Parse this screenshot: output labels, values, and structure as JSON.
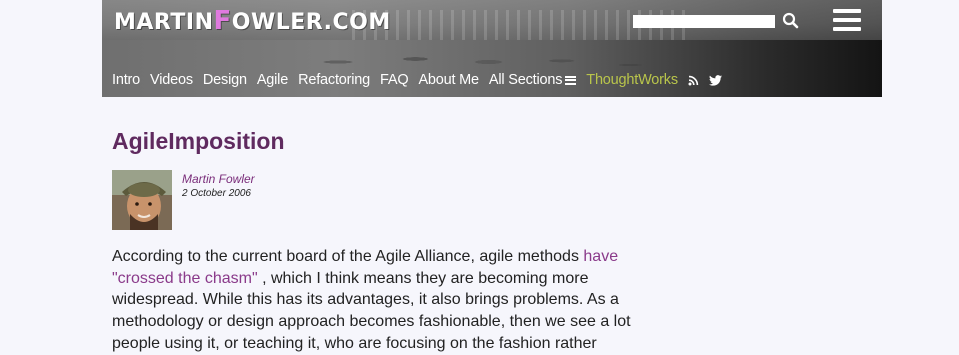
{
  "header": {
    "logo_part1": "MARTIN",
    "logo_f": "F",
    "logo_part2": "OWLER.COM",
    "search_placeholder": "",
    "nav": [
      {
        "label": "Intro"
      },
      {
        "label": "Videos"
      },
      {
        "label": "Design"
      },
      {
        "label": "Agile"
      },
      {
        "label": "Refactoring"
      },
      {
        "label": "FAQ"
      },
      {
        "label": "About Me"
      },
      {
        "label": "All Sections"
      },
      {
        "label": "ThoughtWorks"
      }
    ],
    "icons": [
      "search-icon",
      "menu-icon",
      "rss-icon",
      "twitter-icon"
    ],
    "accent_color": "#b9c54b"
  },
  "article": {
    "title": "AgileImposition",
    "author": "Martin Fowler",
    "date": "2 October 2006",
    "para_before_link": "According to the current board of the Agile Alliance, agile methods ",
    "link_text": "have \"crossed the chasm\"",
    "para_after_link": " , which I think means they are becoming more widespread. While this has its advantages, it also brings problems. As a methodology or design approach becomes fashionable, then we see a lot people using it, or teaching it, who are focusing on the fashion rather",
    "title_color": "#5f2a5f",
    "link_color": "#8a3a8a"
  }
}
